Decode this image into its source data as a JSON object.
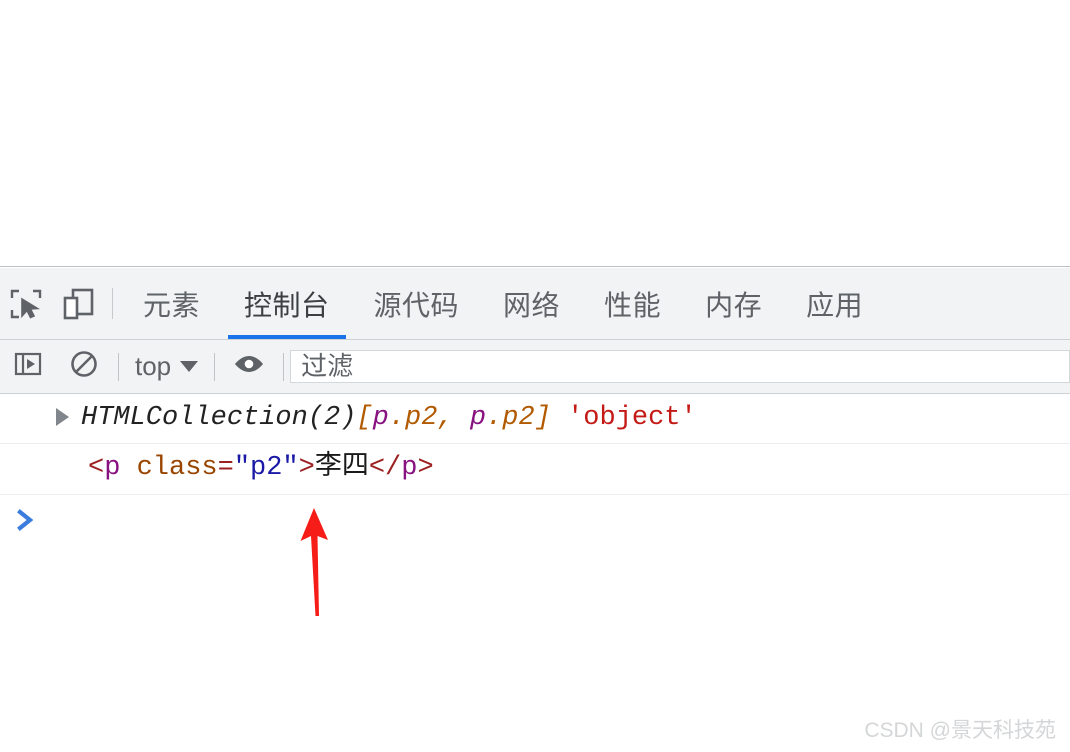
{
  "page": {
    "viewport_background": "#ffffff"
  },
  "devtools": {
    "toolbar_icons": [
      {
        "name": "inspect-element-icon",
        "label": "检查元素"
      },
      {
        "name": "device-toolbar-icon",
        "label": "切换设备工具栏"
      }
    ],
    "tabs": [
      {
        "label": "元素",
        "active": false
      },
      {
        "label": "控制台",
        "active": true
      },
      {
        "label": "源代码",
        "active": false
      },
      {
        "label": "网络",
        "active": false
      },
      {
        "label": "性能",
        "active": false
      },
      {
        "label": "内存",
        "active": false
      },
      {
        "label": "应用",
        "active": false
      }
    ],
    "active_tab": "控制台",
    "accent_color": "#1a73e8",
    "console_toolbar": {
      "sidebar_toggle_icon": "show-console-sidebar-icon",
      "clear_console_icon": "clear-console-icon",
      "context_selector": {
        "value": "top",
        "caret_icon": "chevron-down-icon"
      },
      "eye_icon": "create-live-expression-icon",
      "filter": {
        "value": "",
        "placeholder": "过滤"
      }
    },
    "console_messages": [
      {
        "type": "object-result",
        "expandable": true,
        "expand_icon": "expand-triangle-icon",
        "tokens": [
          {
            "text": "HTMLCollection(2)",
            "kind": "plain-italic"
          },
          {
            "text": " ",
            "kind": "space"
          },
          {
            "text": "[",
            "kind": "bracket"
          },
          {
            "text": "p",
            "kind": "element"
          },
          {
            "text": ".p2",
            "kind": "class"
          },
          {
            "text": ", ",
            "kind": "bracket"
          },
          {
            "text": "p",
            "kind": "element"
          },
          {
            "text": ".p2",
            "kind": "class"
          },
          {
            "text": "]",
            "kind": "bracket"
          },
          {
            "text": " ",
            "kind": "space"
          },
          {
            "text": "'object'",
            "kind": "string"
          }
        ],
        "plain_text": "HTMLCollection(2) [p.p2, p.p2] 'object'"
      },
      {
        "type": "html-markup",
        "expandable": false,
        "tokens": [
          {
            "text": "<",
            "kind": "punct"
          },
          {
            "text": "p",
            "kind": "tag"
          },
          {
            "text": " ",
            "kind": "space"
          },
          {
            "text": "class",
            "kind": "attr"
          },
          {
            "text": "=",
            "kind": "punct"
          },
          {
            "text": "\"p2\"",
            "kind": "value"
          },
          {
            "text": ">",
            "kind": "punct"
          },
          {
            "text": "李四",
            "kind": "plain"
          },
          {
            "text": "</",
            "kind": "punct"
          },
          {
            "text": "p",
            "kind": "tag"
          },
          {
            "text": ">",
            "kind": "punct"
          }
        ],
        "plain_text": "<p class=\"p2\">李四</p>"
      }
    ],
    "prompt": {
      "chevron_icon": "prompt-chevron-icon",
      "chevron_color": "#3b7ddd",
      "value": ""
    }
  },
  "annotation": {
    "arrow": {
      "name": "red-annotation-arrow",
      "color": "#f61c18",
      "direction": "up",
      "points_at": "李四"
    }
  },
  "watermark": {
    "text": "CSDN @景天科技苑",
    "color": "#d4d6d8"
  }
}
